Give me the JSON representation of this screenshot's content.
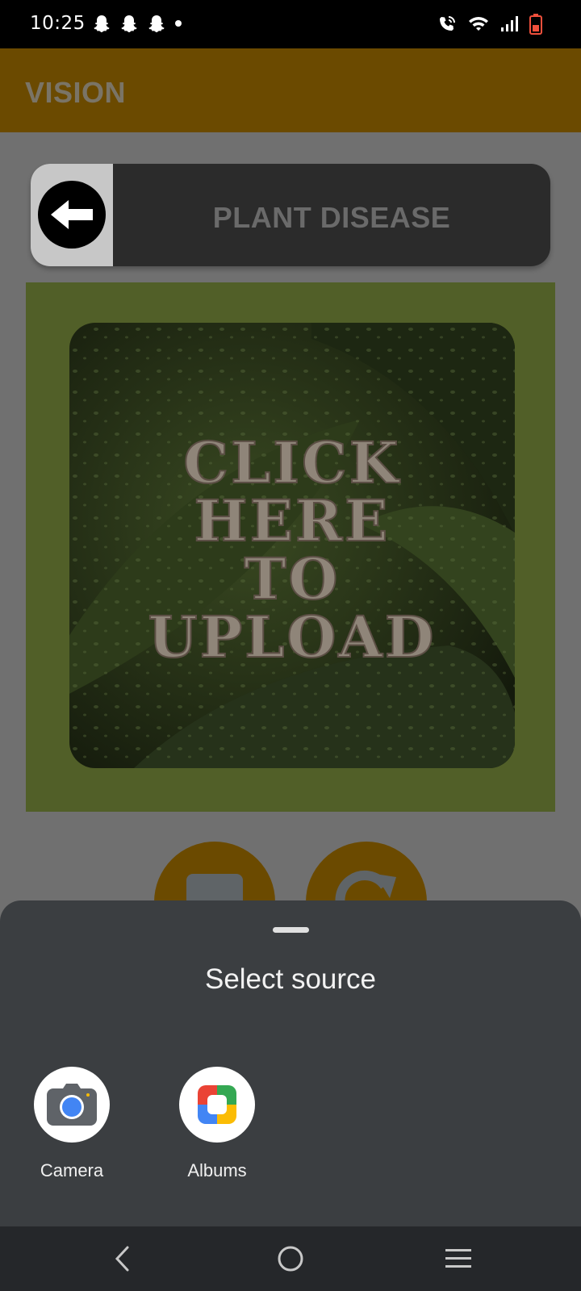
{
  "status_bar": {
    "time": "10:25",
    "notification_icons": [
      "snapchat-icon",
      "snapchat-icon",
      "snapchat-icon",
      "dot-icon"
    ],
    "system_icons": [
      "wifi-calling-icon",
      "wifi-icon",
      "signal-icon",
      "battery-icon"
    ]
  },
  "app_bar": {
    "title": "VISION"
  },
  "header": {
    "title": "PLANT DISEASE",
    "back_icon": "arrow-left-icon"
  },
  "upload": {
    "lines": [
      "CLICK",
      "HERE",
      "TO",
      "UPLOAD"
    ]
  },
  "action_buttons": [
    "gallery-icon",
    "refresh-icon"
  ],
  "sheet": {
    "title": "Select source",
    "options": [
      {
        "label": "Camera",
        "icon": "camera-icon"
      },
      {
        "label": "Albums",
        "icon": "albums-icon"
      }
    ]
  },
  "nav_bar": {
    "buttons": [
      "back-icon",
      "home-icon",
      "recents-icon"
    ]
  },
  "colors": {
    "app_bar": "#6b4a00",
    "header_card": "#2b2b2b",
    "upload_panel": "#515f28",
    "sheet": "#3b3e41",
    "nav_bar": "#25272a"
  }
}
